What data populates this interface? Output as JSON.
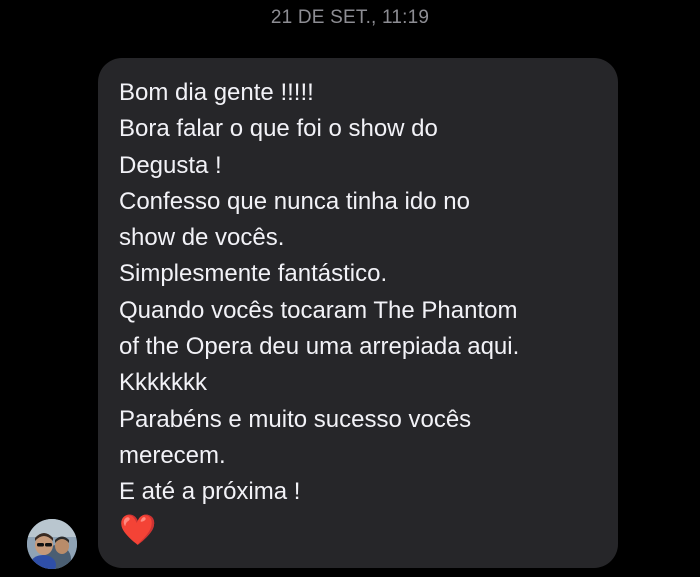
{
  "conversation": {
    "timestamp": "21 DE SET., 11:19",
    "message": {
      "lines": [
        "Bom dia gente !!!!!",
        "Bora falar o que foi o show do",
        "Degusta !",
        "Confesso que nunca tinha ido no",
        "show de vocês.",
        "Simplesmente fantástico.",
        "Quando vocês tocaram The Phantom",
        "of the Opera deu uma arrepiada aqui.",
        "Kkkkkkk",
        "Parabéns e muito sucesso vocês",
        "merecem.",
        "E até a próxima !"
      ],
      "emoji": "❤️",
      "emoji_icon": "red-heart-emoji",
      "bubble_color": "#262629",
      "text_color": "#f2f2f7"
    },
    "sender": {
      "avatar_icon": "user-avatar-photo"
    }
  },
  "colors": {
    "background": "#000000",
    "timestamp": "#8d8d93"
  }
}
